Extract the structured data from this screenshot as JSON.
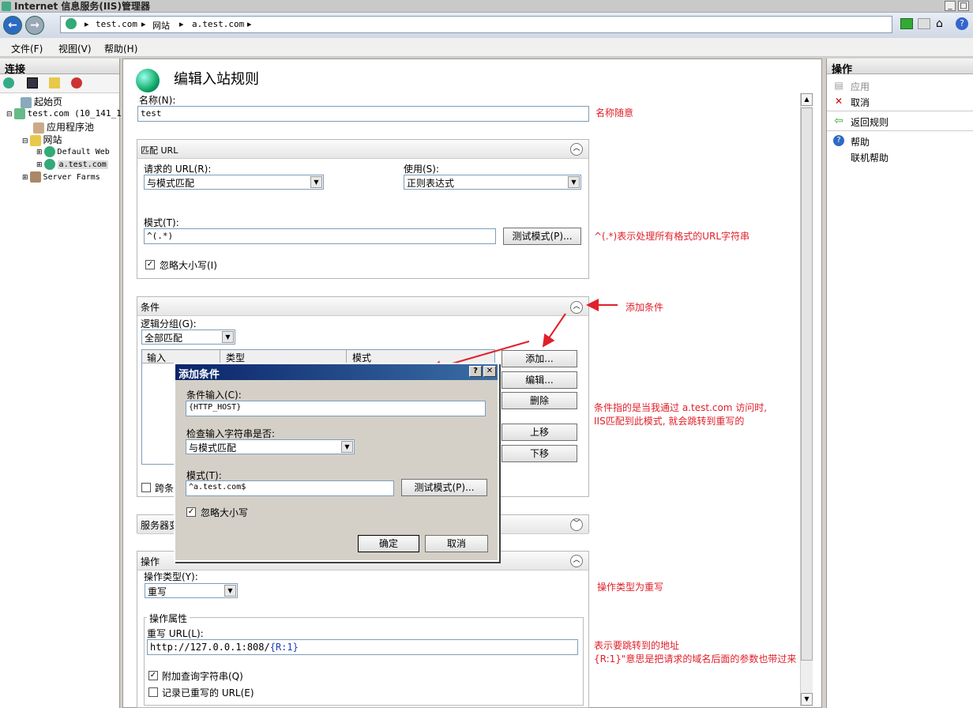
{
  "window": {
    "title": "Internet 信息服务(IIS)管理器"
  },
  "address": {
    "crumbs": [
      "test.com",
      "网站",
      "a.test.com"
    ]
  },
  "menu": [
    "文件(F)",
    "视图(V)",
    "帮助(H)"
  ],
  "connections": {
    "title": "连接",
    "tree": [
      "起始页",
      "test.com (10_141_1",
      "应用程序池",
      "网站",
      "Default Web",
      "a.test.com",
      "Server Farms"
    ]
  },
  "page": {
    "title": "编辑入站规则",
    "name_label": "名称(N):",
    "name_value": "test",
    "match": {
      "title": "匹配 URL",
      "requested_label": "请求的 URL(R):",
      "requested_value": "与模式匹配",
      "using_label": "使用(S):",
      "using_value": "正则表达式",
      "pattern_label": "模式(T):",
      "pattern_value": "^(.*)",
      "test_button": "测试模式(P)...",
      "ignore_case": "忽略大小写(I)"
    },
    "conditions": {
      "title": "条件",
      "logical_label": "逻辑分组(G):",
      "logical_value": "全部匹配",
      "columns": [
        "输入",
        "类型",
        "模式"
      ],
      "add": "添加...",
      "edit": "编辑...",
      "delete": "删除",
      "up": "上移",
      "down": "下移",
      "track": "跨条"
    },
    "server_vars": {
      "title": "服务器变"
    },
    "action": {
      "title": "操作",
      "type_label": "操作类型(Y):",
      "type_value": "重写",
      "props_title": "操作属性",
      "rewrite_label": "重写 URL(L):",
      "rewrite_value_plain": "http://127.0.0.1:808/",
      "rewrite_value_tag": "{R:1}",
      "append_query": "附加查询字符串(Q)",
      "log_rewritten": "记录已重写的 URL(E)"
    }
  },
  "dialog": {
    "title": "添加条件",
    "help": "?",
    "close": "✕",
    "input_label": "条件输入(C):",
    "input_value": "{HTTP_HOST}",
    "check_label": "检查输入字符串是否:",
    "check_value": "与模式匹配",
    "pattern_label": "模式(T):",
    "pattern_value": "^a.test.com$",
    "test_button": "测试模式(P)...",
    "ignore_case": "忽略大小写",
    "ok": "确定",
    "cancel": "取消"
  },
  "actions": {
    "title": "操作",
    "apply": "应用",
    "cancel": "取消",
    "back": "返回规则",
    "help": "帮助",
    "online_help": "联机帮助"
  },
  "annotations": {
    "name": "名称随意",
    "pattern": "^(.*)表示处理所有格式的URL字符串",
    "add": "添加条件",
    "cond1": "条件指的是当我通过 a.test.com 访问时,",
    "cond2": "IIS匹配到此模式, 就会跳转到重写的",
    "action": "操作类型为重写",
    "rewrite1": "表示要跳转到的地址",
    "rewrite2": "{R:1}\"意思是把请求的域名后面的参数也带过来"
  },
  "colors": {
    "annotation": "#e0202a",
    "dialog_caption": "#0a246a"
  }
}
